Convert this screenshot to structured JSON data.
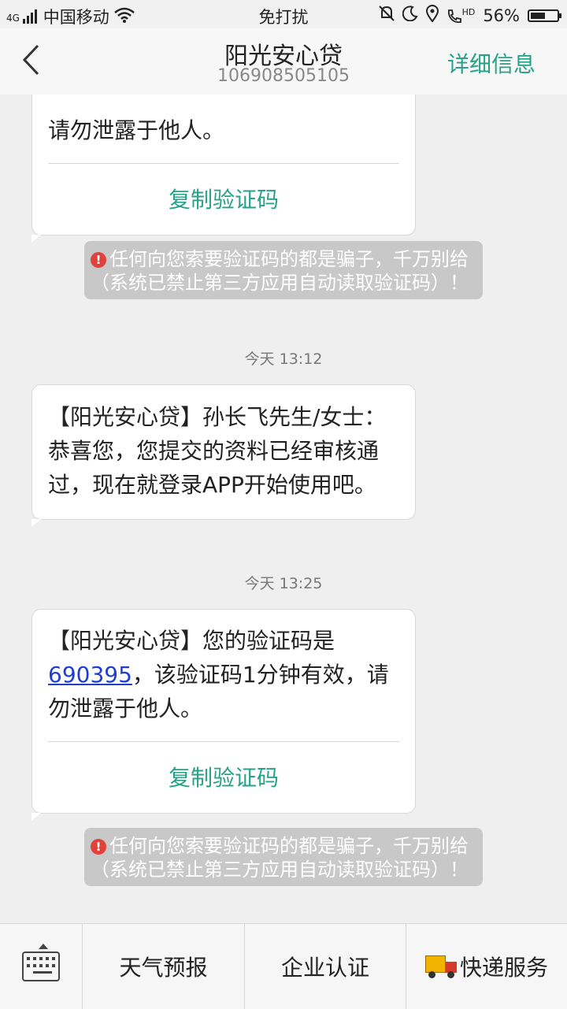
{
  "status_bar": {
    "network": "4G",
    "carrier": "中国移动",
    "mode": "免打扰",
    "hd": "HD",
    "battery_percent": "56%",
    "battery_level": 0.56
  },
  "header": {
    "back_glyph": "〈",
    "title": "阳光安心贷",
    "number": "106908505105",
    "detail_label": "详细信息"
  },
  "messages": [
    {
      "text_line": "请勿泄露于他人。",
      "copy_label": "复制验证码",
      "warning": "任何向您索要验证码的都是骗子，千万别给（系统已禁止第三方应用自动读取验证码）！"
    },
    {
      "time": "今天  13:12",
      "text": "【阳光安心贷】孙长飞先生/女士：恭喜您，您提交的资料已经审核通过，现在就登录APP开始使用吧。"
    },
    {
      "time": "今天  13:25",
      "text_before": "【阳光安心贷】您的验证码是",
      "code": "690395",
      "text_after": "，该验证码1分钟有效，请勿泄露于他人。",
      "copy_label": "复制验证码",
      "warning": "任何向您索要验证码的都是骗子，千万别给（系统已禁止第三方应用自动读取验证码）！"
    }
  ],
  "bottom_menu": {
    "items": [
      "天气预报",
      "企业认证",
      "快递服务"
    ]
  },
  "icons": {
    "warning": "!",
    "colors": {
      "accent": "#27a189",
      "link": "#1f3ed1",
      "warning_red": "#e0413b"
    }
  }
}
